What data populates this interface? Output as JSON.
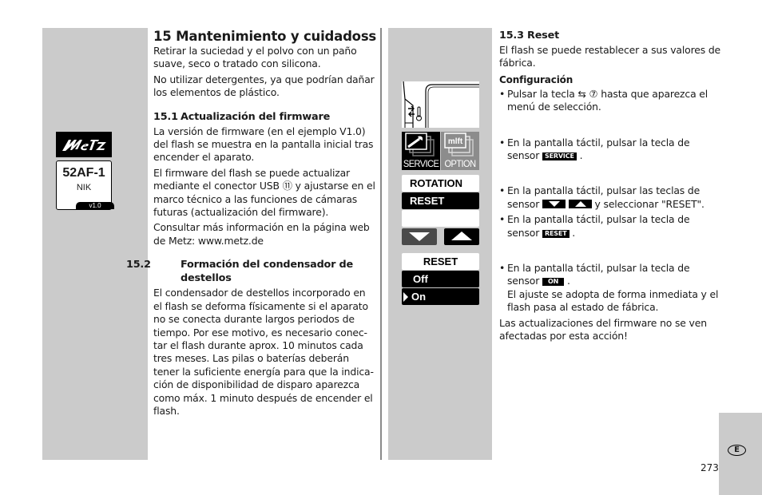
{
  "page": {
    "number": "273",
    "language_badge": "E"
  },
  "left": {
    "title": "15 Mantenimiento y cuidadoss",
    "intro": [
      "Retirar la suciedad y el polvo con un paño suave, seco o tratado con silicona.",
      "No utilizar detergentes, ya que podrían dañar los elementos de plástico."
    ],
    "sections": [
      {
        "number": "15.1",
        "title": "Actualización del firmware",
        "paragraphs": [
          "La versión de firmware (en el ejemplo V1.0) del flash se muestra en la pantalla inicial tras encender el aparato.",
          "El firmware del flash se puede actualizar mediante el conector USB ⑪ y ajustarse en el marco técnico a las funciones de cámaras futuras (actualización del firmware).",
          "Consultar más información en la página web de Metz: www.metz.de"
        ]
      },
      {
        "number": "15.2",
        "title": "Formación del condensador de destellos",
        "paragraphs": [
          "El condensador de destellos incorporado en el flash se deforma físicamente si el aparato no se conecta durante largos periodos de tiempo. Por ese motivo, es necesario conec-tar el flash durante aprox. 10 minutos cada tres meses. Las pilas o baterías deberán tener la suficiente energía para que la indica-ción de disponibilidad de disparo aparezca como máx. 1 minuto después de encender el flash."
        ]
      }
    ]
  },
  "display": {
    "brand": "Metz",
    "model": "52AF-1",
    "variant": "NIK",
    "version": "v1.0"
  },
  "screens": {
    "service_label": "SERVICE",
    "option_label": "OPTION",
    "option_icon_text": "mlft",
    "menu_items": [
      "ROTATION",
      "RESET"
    ],
    "reset_title": "RESET",
    "reset_options": [
      "Off",
      "On"
    ],
    "reset_selected": "On"
  },
  "right": {
    "section_number": "15.3",
    "section_title": "Reset",
    "intro": "El flash se puede restablecer a sus valores de fábrica.",
    "config_heading": "Configuración",
    "steps": [
      {
        "before": "Pulsar la tecla ⇆ ⑦ hasta que aparezca el menú de selección."
      },
      {
        "before": "En la pantalla táctil, pulsar la tecla de sensor ",
        "key": "SERVICE",
        "after": " ."
      },
      {
        "before": "En la pantalla táctil, pulsar las teclas de sensor ",
        "after": " y seleccionar \"RESET\"."
      },
      {
        "before": "En la pantalla táctil, pulsar la tecla de sensor ",
        "key": "RESET",
        "after": " ."
      },
      {
        "before": "En la pantalla táctil, pulsar la tecla de sensor ",
        "key": "ON",
        "after": " .",
        "note": "El ajuste se adopta de forma inmediata y el flash pasa al estado de fábrica."
      }
    ],
    "footer_note": "Las actualizaciones del firmware no se ven afectadas por esta acción!"
  }
}
